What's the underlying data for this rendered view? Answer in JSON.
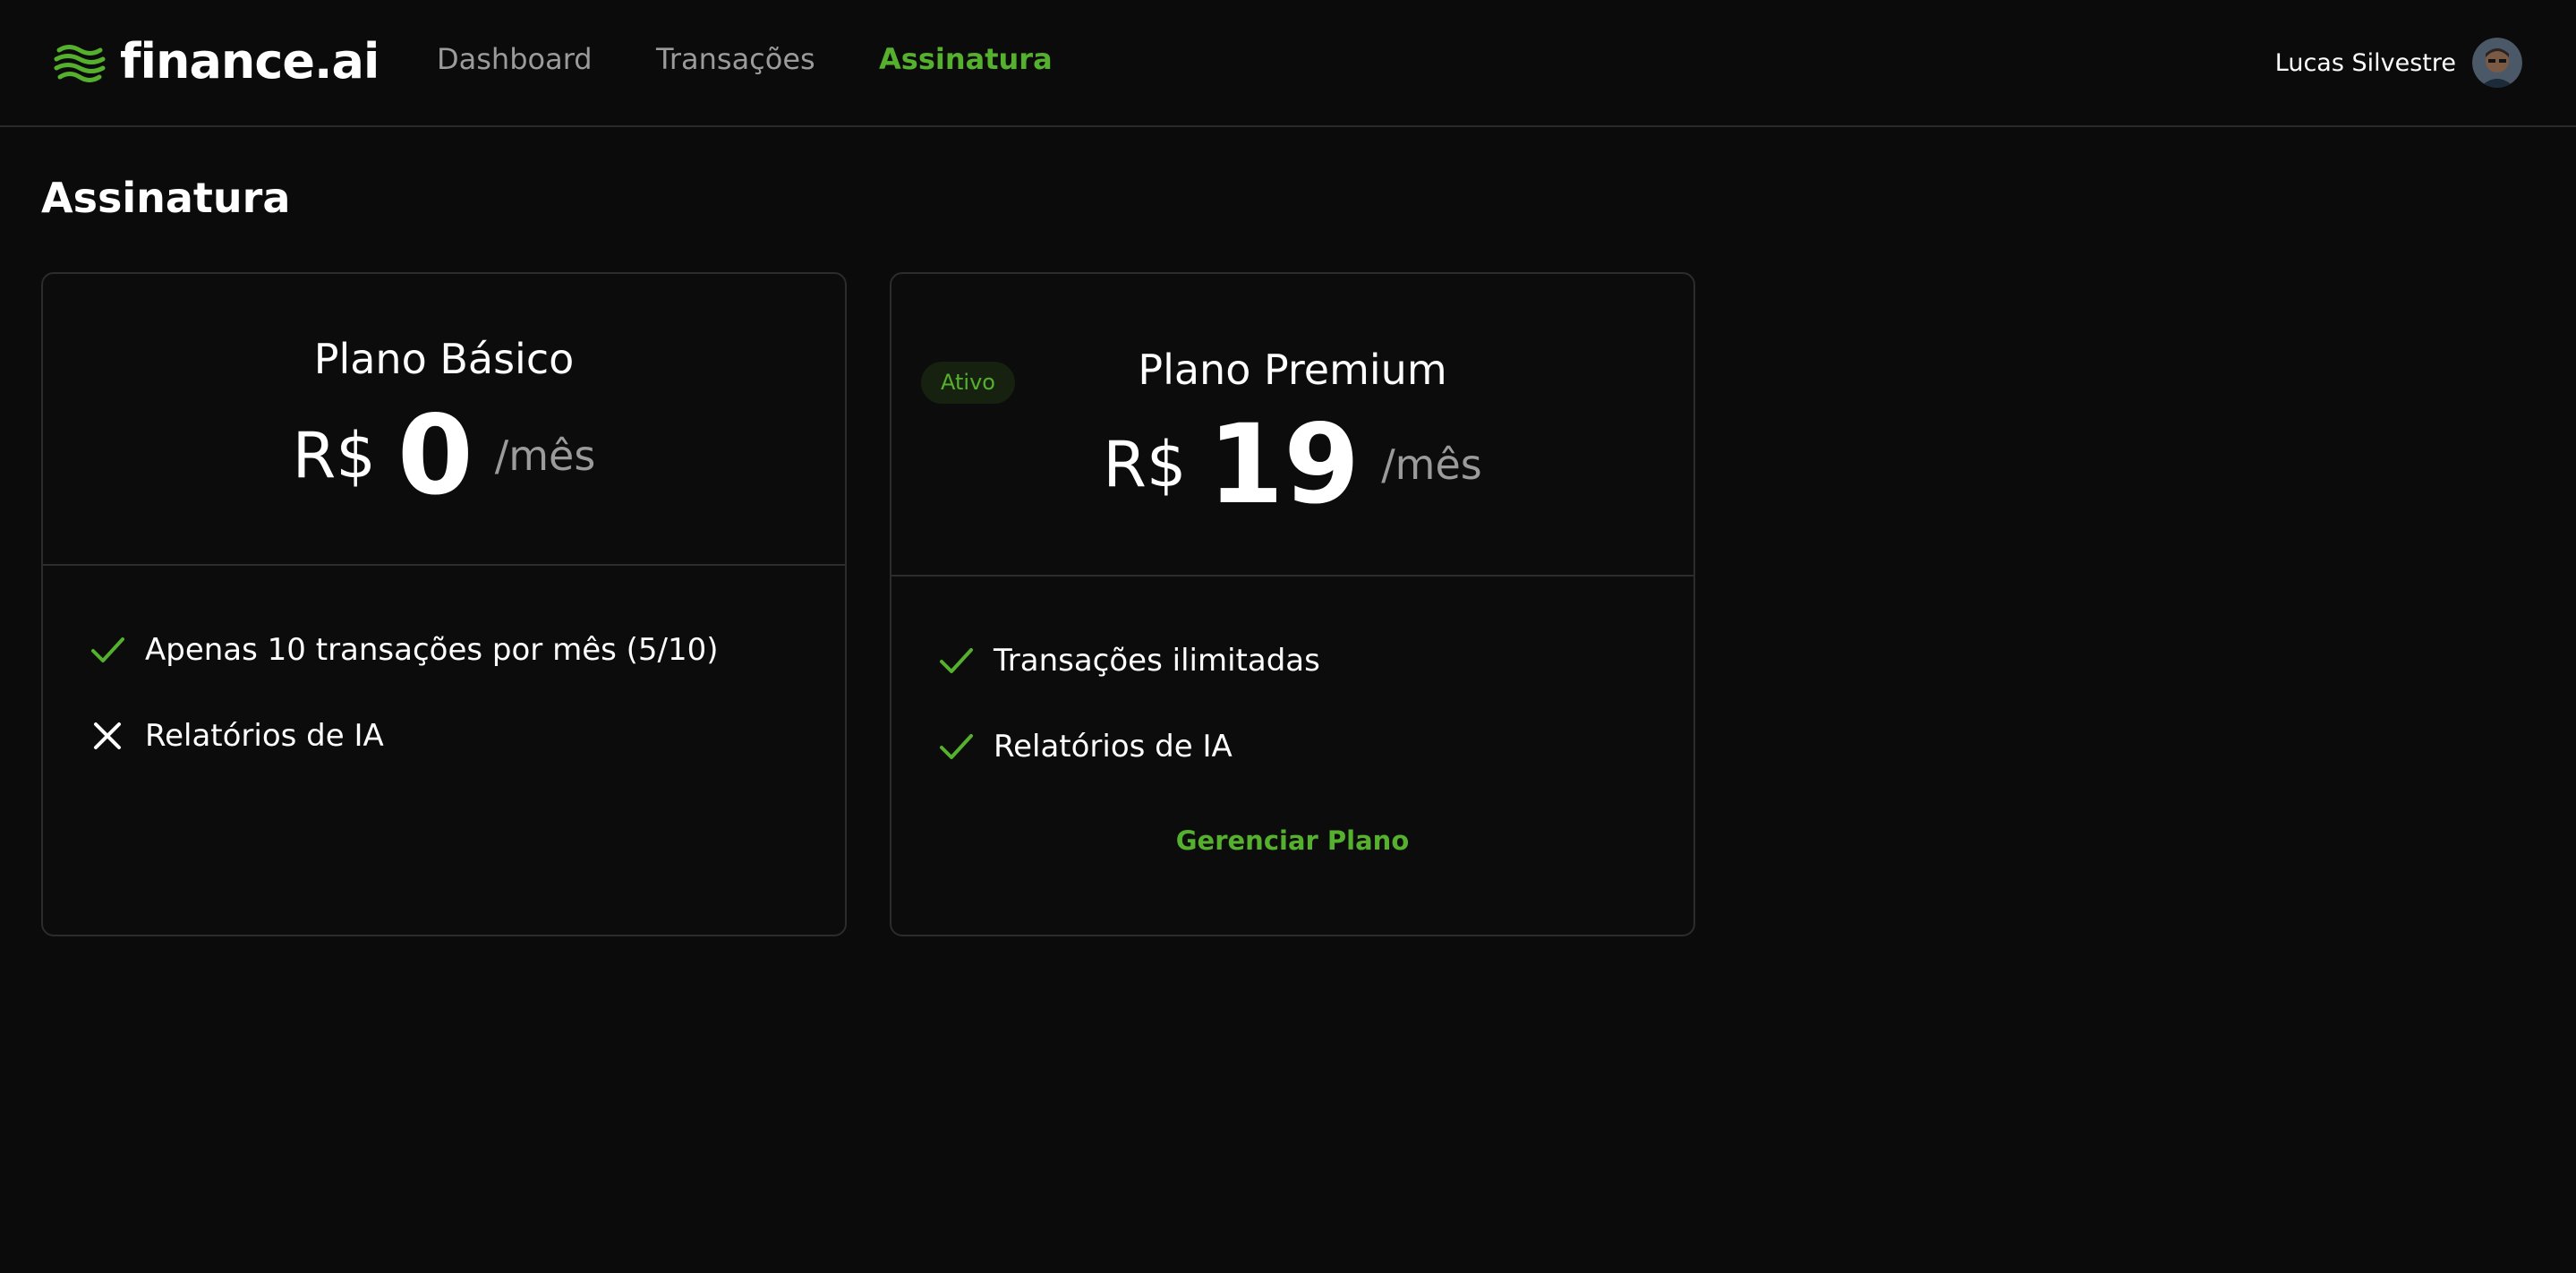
{
  "brand": {
    "name": "finance.ai",
    "icon": "wave-logo-icon",
    "accent_color": "#55b02e"
  },
  "nav": {
    "items": [
      {
        "label": "Dashboard",
        "active": false
      },
      {
        "label": "Transações",
        "active": false
      },
      {
        "label": "Assinatura",
        "active": true
      }
    ]
  },
  "user": {
    "name": "Lucas Silvestre",
    "avatar": "user-avatar"
  },
  "page": {
    "title": "Assinatura"
  },
  "plans": [
    {
      "name": "Plano Básico",
      "currency": "R$",
      "price": "0",
      "period": "/mês",
      "features": [
        {
          "text": "Apenas 10 transações por mês (5/10)",
          "included": true,
          "icon": "check-icon"
        },
        {
          "text": "Relatórios de IA",
          "included": false,
          "icon": "x-icon"
        }
      ]
    },
    {
      "name": "Plano Premium",
      "badge": "Ativo",
      "currency": "R$",
      "price": "19",
      "period": "/mês",
      "features": [
        {
          "text": "Transações ilimitadas",
          "included": true,
          "icon": "check-icon"
        },
        {
          "text": "Relatórios de IA",
          "included": true,
          "icon": "check-icon"
        }
      ],
      "action_label": "Gerenciar Plano"
    }
  ]
}
